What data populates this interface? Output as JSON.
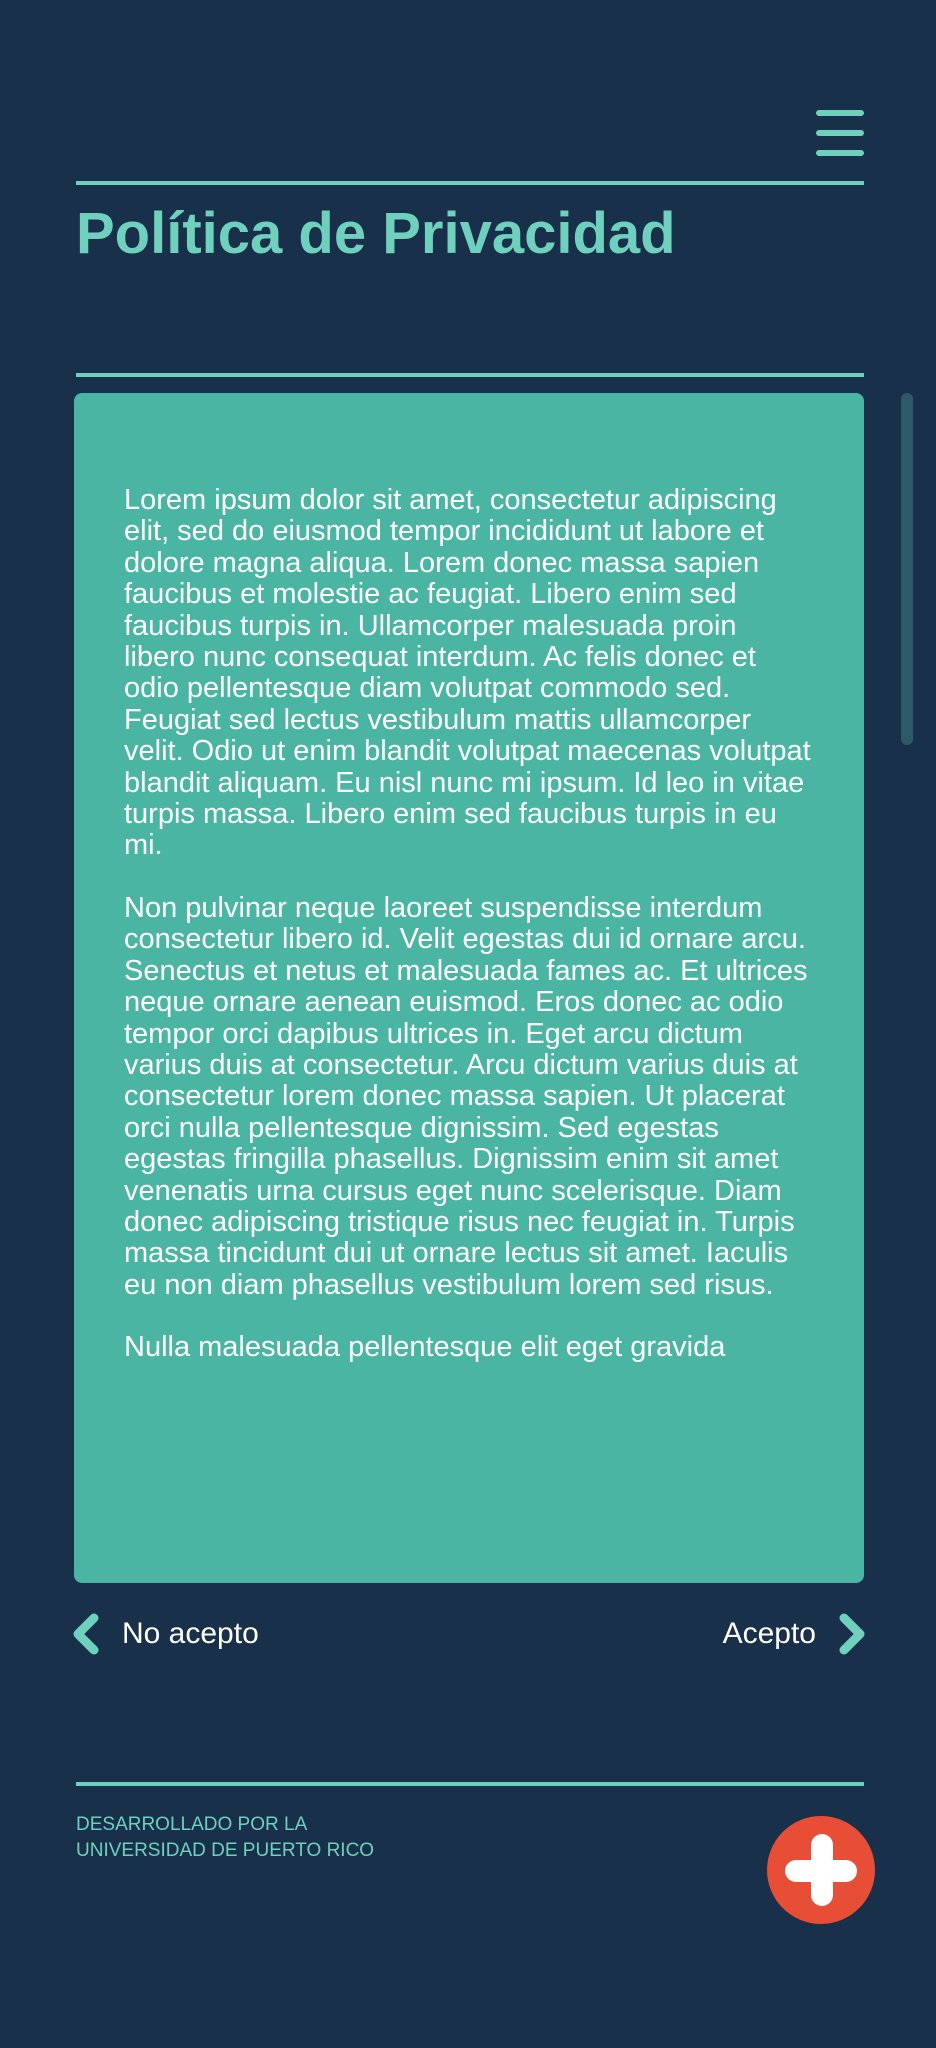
{
  "header": {
    "menu_icon": "hamburger-menu-icon",
    "title": "Política de Privacidad"
  },
  "content": {
    "paragraphs": [
      "Lorem ipsum dolor sit amet, consectetur adipiscing elit, sed do eiusmod tempor incididunt ut labore et dolore magna aliqua. Lorem donec massa sapien faucibus et molestie ac feugiat. Libero enim sed faucibus turpis in. Ullamcorper malesuada proin libero nunc consequat interdum. Ac felis donec et odio pellentesque diam volutpat commodo sed. Feugiat sed lectus vestibulum mattis ullamcorper velit. Odio ut enim blandit volutpat maecenas volutpat blandit aliquam. Eu nisl nunc mi ipsum. Id leo in vitae turpis massa. Libero enim sed faucibus turpis in eu mi.",
      "Non pulvinar neque laoreet suspendisse interdum consectetur libero id. Velit egestas dui id ornare arcu. Senectus et netus et malesuada fames ac. Et ultrices neque ornare aenean euismod. Eros donec ac odio tempor orci dapibus ultrices in. Eget arcu dictum varius duis at consectetur. Arcu dictum varius duis at consectetur lorem donec massa sapien. Ut placerat orci nulla pellentesque dignissim. Sed egestas egestas fringilla phasellus. Dignissim enim sit amet venenatis urna cursus eget nunc scelerisque. Diam donec adipiscing tristique risus nec feugiat in. Turpis massa tincidunt dui ut ornare lectus sit amet. Iaculis eu non diam phasellus vestibulum lorem sed risus.",
      "Nulla malesuada pellentesque elit eget gravida"
    ]
  },
  "actions": {
    "decline_label": "No acepto",
    "decline_icon": "chevron-left-icon",
    "accept_label": "Acepto",
    "accept_icon": "chevron-right-icon"
  },
  "footer": {
    "credit_line_1": "DESARROLLADO POR LA",
    "credit_line_2": "UNIVERSIDAD DE PUERTO RICO",
    "fab_icon": "plus-icon"
  },
  "colors": {
    "background": "#183049",
    "accent": "#6fd0bd",
    "card": "#4bb5a3",
    "fab": "#e84e36",
    "text": "#ffffff"
  }
}
